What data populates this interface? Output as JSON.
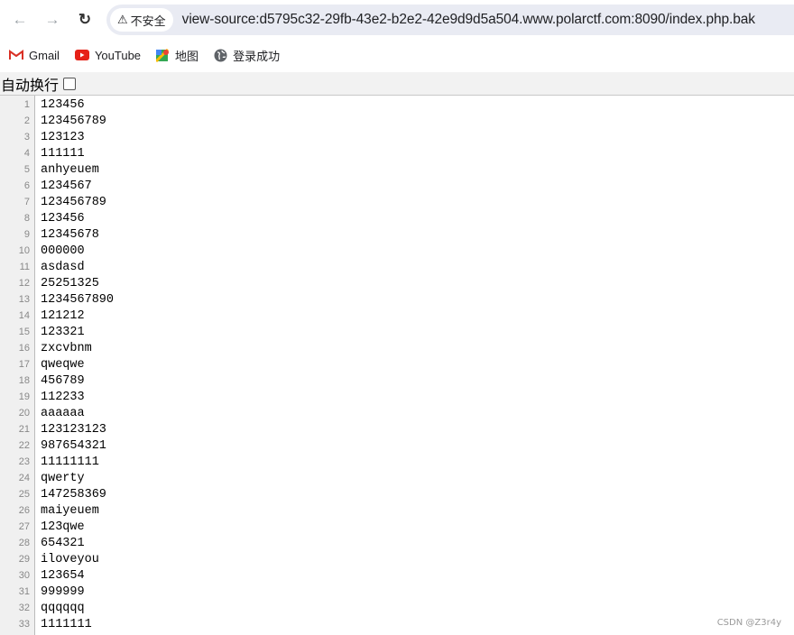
{
  "browser": {
    "security_label": "不安全",
    "url": "view-source:d5795c32-29fb-43e2-b2e2-42e9d9d5a504.www.polarctf.com:8090/index.php.bak",
    "bookmarks": [
      {
        "label": "Gmail",
        "icon": "gmail-icon"
      },
      {
        "label": "YouTube",
        "icon": "youtube-icon"
      },
      {
        "label": "地图",
        "icon": "maps-icon"
      },
      {
        "label": "登录成功",
        "icon": "globe-icon"
      }
    ]
  },
  "viewsource": {
    "wrap_label": "自动换行",
    "wrap_checked": false,
    "lines": [
      {
        "n": "1",
        "t": "123456"
      },
      {
        "n": "2",
        "t": "123456789"
      },
      {
        "n": "3",
        "t": "123123"
      },
      {
        "n": "4",
        "t": "111111"
      },
      {
        "n": "5",
        "t": "anhyeuem"
      },
      {
        "n": "6",
        "t": "1234567"
      },
      {
        "n": "7",
        "t": "123456789"
      },
      {
        "n": "8",
        "t": "123456"
      },
      {
        "n": "9",
        "t": "12345678"
      },
      {
        "n": "10",
        "t": "000000"
      },
      {
        "n": "11",
        "t": "asdasd"
      },
      {
        "n": "12",
        "t": "25251325"
      },
      {
        "n": "13",
        "t": "1234567890"
      },
      {
        "n": "14",
        "t": "121212"
      },
      {
        "n": "15",
        "t": "123321"
      },
      {
        "n": "16",
        "t": "zxcvbnm"
      },
      {
        "n": "17",
        "t": "qweqwe"
      },
      {
        "n": "18",
        "t": "456789"
      },
      {
        "n": "19",
        "t": "112233"
      },
      {
        "n": "20",
        "t": "aaaaaa"
      },
      {
        "n": "21",
        "t": "123123123"
      },
      {
        "n": "22",
        "t": "987654321"
      },
      {
        "n": "23",
        "t": "11111111"
      },
      {
        "n": "24",
        "t": "qwerty"
      },
      {
        "n": "25",
        "t": "147258369"
      },
      {
        "n": "26",
        "t": "maiyeuem"
      },
      {
        "n": "27",
        "t": "123qwe"
      },
      {
        "n": "28",
        "t": "654321"
      },
      {
        "n": "29",
        "t": "iloveyou"
      },
      {
        "n": "30",
        "t": "123654"
      },
      {
        "n": "31",
        "t": "999999"
      },
      {
        "n": "32",
        "t": "qqqqqq"
      },
      {
        "n": "33",
        "t": "1111111"
      }
    ]
  },
  "watermark": "CSDN @Z3r4y"
}
